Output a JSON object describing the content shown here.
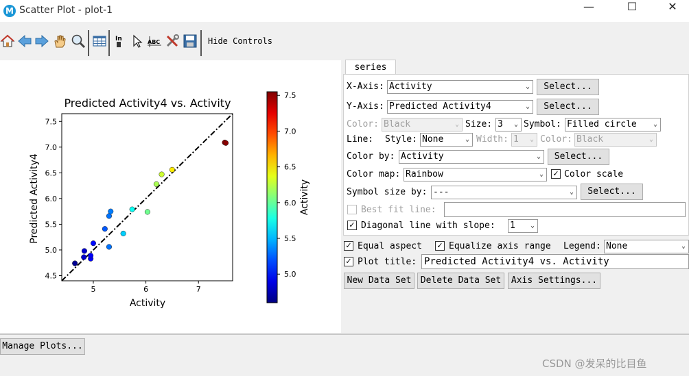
{
  "window": {
    "title": "Scatter Plot - plot-1",
    "icon_letter": "M",
    "minimize": "—",
    "maximize": "☐",
    "close": "✕"
  },
  "toolbar": {
    "hide_controls": "Hide Controls",
    "icons": [
      "home-icon",
      "back-arrow-icon",
      "forward-arrow-icon",
      "pan-hand-icon",
      "zoom-icon",
      "table-icon",
      "data-cursor-icon",
      "select-pointer-icon",
      "text-label-icon",
      "tools-icon",
      "save-icon"
    ]
  },
  "tabs": {
    "series": "series"
  },
  "series": {
    "x_axis_label": "X-Axis:",
    "x_axis_value": "Activity",
    "x_select": "Select...",
    "y_axis_label": "Y-Axis:",
    "y_axis_value": "Predicted Activity4",
    "y_select": "Select...",
    "color_label": "Color:",
    "color_value": "Black",
    "size_label": "Size:",
    "size_value": "3",
    "symbol_label": "Symbol:",
    "symbol_value": "Filled circle",
    "line_label": "Line:",
    "style_label": "Style:",
    "style_value": "None",
    "width_label": "Width:",
    "width_value": "1",
    "line_color_label": "Color:",
    "line_color_value": "Black",
    "color_by_label": "Color by:",
    "color_by_value": "Activity",
    "color_by_select": "Select...",
    "color_map_label": "Color map:",
    "color_map_value": "Rainbow",
    "color_scale_label": "Color scale",
    "color_scale_checked": true,
    "symbol_size_label": "Symbol size by:",
    "symbol_size_value": "---",
    "symbol_size_select": "Select...",
    "best_fit_label": "Best fit line:",
    "best_fit_checked": false,
    "best_fit_value": "",
    "diagonal_label": "Diagonal line with slope:",
    "diagonal_checked": true,
    "diagonal_value": "1"
  },
  "options": {
    "equal_aspect_label": "Equal aspect",
    "equal_aspect_checked": true,
    "equalize_label": "Equalize axis range",
    "equalize_checked": true,
    "legend_label": "Legend:",
    "legend_value": "None",
    "plot_title_label": "Plot title:",
    "plot_title_checked": true,
    "plot_title_value": "Predicted Activity4 vs. Activity",
    "new_data_set": "New Data Set",
    "delete_data_set": "Delete Data Set",
    "axis_settings": "Axis Settings..."
  },
  "manage_plots": "Manage Plots...",
  "watermark": "CSDN @发呆的比目鱼",
  "chart_data": {
    "type": "scatter",
    "title": "Predicted Activity4 vs. Activity",
    "xlabel": "Activity",
    "ylabel": "Predicted Activity4",
    "xlim": [
      4.4,
      7.65
    ],
    "ylim": [
      4.4,
      7.65
    ],
    "xticks": [
      "5",
      "6",
      "7"
    ],
    "yticks": [
      "4.5",
      "5.0",
      "5.5",
      "6.0",
      "6.5",
      "7.0",
      "7.5"
    ],
    "x_tick_values": [
      5,
      6,
      7
    ],
    "y_tick_values": [
      4.5,
      5.0,
      5.5,
      6.0,
      6.5,
      7.0,
      7.5
    ],
    "diagonal_slope": 1,
    "colorbar": {
      "label": "Activity",
      "min": 4.6,
      "max": 7.55,
      "ticks": [
        "5.0",
        "5.5",
        "6.0",
        "6.5",
        "7.0",
        "7.5"
      ],
      "tick_values": [
        5.0,
        5.5,
        6.0,
        6.5,
        7.0,
        7.5
      ]
    },
    "points": [
      {
        "x": 4.65,
        "y": 4.74
      },
      {
        "x": 4.82,
        "y": 4.86
      },
      {
        "x": 4.83,
        "y": 4.98
      },
      {
        "x": 4.95,
        "y": 4.83
      },
      {
        "x": 4.95,
        "y": 4.89
      },
      {
        "x": 5.0,
        "y": 5.13
      },
      {
        "x": 5.22,
        "y": 5.41
      },
      {
        "x": 5.3,
        "y": 5.06
      },
      {
        "x": 5.3,
        "y": 5.66
      },
      {
        "x": 5.33,
        "y": 5.75
      },
      {
        "x": 5.57,
        "y": 5.32
      },
      {
        "x": 5.74,
        "y": 5.79
      },
      {
        "x": 6.03,
        "y": 5.74
      },
      {
        "x": 6.2,
        "y": 6.28
      },
      {
        "x": 6.3,
        "y": 6.47
      },
      {
        "x": 6.5,
        "y": 6.56
      },
      {
        "x": 7.5,
        "y": 7.09
      },
      {
        "x": 7.52,
        "y": 7.08
      }
    ]
  }
}
